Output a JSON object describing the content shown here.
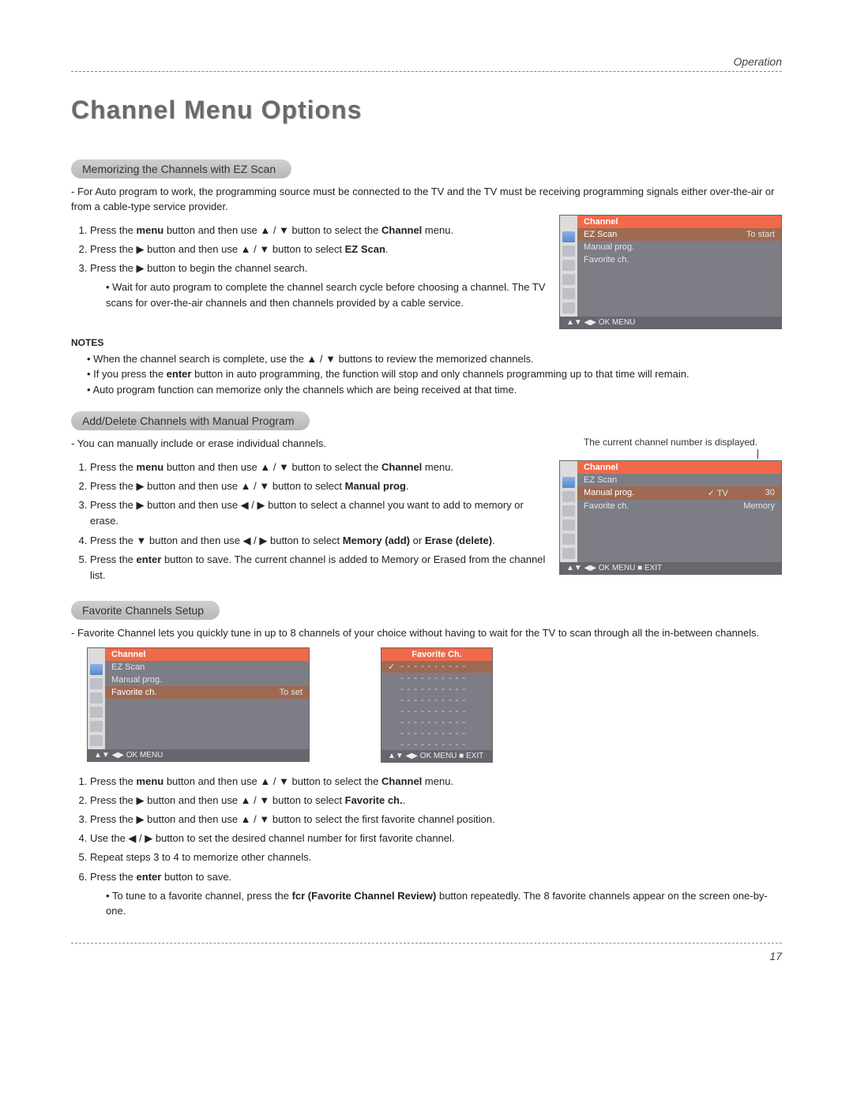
{
  "header": {
    "section": "Operation"
  },
  "title": "Channel Menu Options",
  "page_number": "17",
  "sec1": {
    "pill": "Memorizing the Channels with EZ Scan",
    "intro": "- For Auto program to work, the programming source must be connected to the TV and the TV must be receiving programming signals either over-the-air or from a cable-type service provider.",
    "step1_a": "Press the ",
    "step1_menu": "menu",
    "step1_b": " button and then use ▲ / ▼ button to select the ",
    "step1_channel": "Channel",
    "step1_c": " menu.",
    "step2_a": "Press the ▶ button and then use ▲ / ▼ button to select ",
    "step2_bold": "EZ Scan",
    "step2_b": ".",
    "step3": "Press the ▶ button to begin the channel search.",
    "step3_sub": "Wait for auto program to complete the channel search cycle before choosing a channel. The TV scans for over-the-air channels and then channels provided by a cable service.",
    "notes_label": "NOTES",
    "note1": "When the channel search is complete, use the ▲ / ▼ buttons to review the memorized channels.",
    "note2_a": "If you press the ",
    "note2_bold": "enter",
    "note2_b": " button in auto programming, the function will stop and only channels programming up to that time will remain.",
    "note3": "Auto program function can memorize only the channels which are being received at that time."
  },
  "sec2": {
    "pill": "Add/Delete Channels with Manual Program",
    "intro": "-  You can manually include or erase individual channels.",
    "caption": "The current channel number is displayed.",
    "step1_a": "Press the ",
    "step1_menu": "menu",
    "step1_b": " button and then use ▲ / ▼ button to select the ",
    "step1_channel": "Channel",
    "step1_c": " menu.",
    "step2_a": "Press the ▶ button and then use ▲ / ▼ button to select ",
    "step2_bold": "Manual prog",
    "step2_b": ".",
    "step3": "Press the ▶ button and then use ◀ / ▶ button to select a channel you want to add to memory or erase.",
    "step4_a": "Press the ▼ button and then use ◀ / ▶ button to select ",
    "step4_bold1": "Memory (add)",
    "step4_mid": " or ",
    "step4_bold2": "Erase (delete)",
    "step4_b": ".",
    "step5_a": "Press the ",
    "step5_bold": "enter",
    "step5_b": " button to save. The current channel is added to Memory or Erased from the channel list."
  },
  "sec3": {
    "pill": "Favorite Channels Setup",
    "intro": "-  Favorite Channel lets you quickly tune in up to 8 channels of your choice without having to wait for the TV to scan through all the in-between channels.",
    "step1_a": "Press the ",
    "step1_menu": "menu",
    "step1_b": " button and then use ▲ / ▼ button to select the ",
    "step1_channel": "Channel",
    "step1_c": " menu.",
    "step2_a": "Press the ▶ button and then use ▲ / ▼ button to select ",
    "step2_bold": "Favorite ch.",
    "step2_b": ".",
    "step3": "Press the ▶ button and then use ▲ / ▼ button to select the first favorite channel position.",
    "step4": "Use the ◀ / ▶ button to set the desired channel number for first favorite channel.",
    "step5": "Repeat steps 3 to 4 to memorize other channels.",
    "step6_a": "Press the ",
    "step6_bold": "enter",
    "step6_b": " button to save.",
    "step6_sub_a": "To tune to a favorite channel, press the ",
    "step6_sub_bold": "fcr (Favorite Channel Review)",
    "step6_sub_b": " button repeatedly. The 8 favorite channels appear on the screen one-by-one."
  },
  "osd1": {
    "title": "Channel",
    "items": [
      {
        "label": "EZ Scan",
        "value": "To start",
        "selected": true
      },
      {
        "label": "Manual prog.",
        "value": ""
      },
      {
        "label": "Favorite ch.",
        "value": ""
      }
    ],
    "foot": "▲▼  ◀▶  OK  MENU"
  },
  "osd2": {
    "title": "Channel",
    "items": [
      {
        "label": "EZ Scan",
        "value": ""
      },
      {
        "label": "Manual prog.",
        "value": "✓ TV",
        "value2": "30",
        "selected": true
      },
      {
        "label": "Favorite ch.",
        "value": "Memory"
      }
    ],
    "foot": "▲▼  ◀▶  OK  MENU  ■ EXIT"
  },
  "osd3": {
    "title": "Channel",
    "items": [
      {
        "label": "EZ Scan",
        "value": ""
      },
      {
        "label": "Manual prog.",
        "value": ""
      },
      {
        "label": "Favorite ch.",
        "value": "To set",
        "selected": true
      }
    ],
    "foot": "▲▼  ◀▶  OK  MENU"
  },
  "osd4": {
    "title": "Favorite Ch.",
    "rows": [
      {
        "check": "✓",
        "value": "- - - - - - - - - -",
        "selected": true
      },
      {
        "check": "",
        "value": "- - - - - - - - - -"
      },
      {
        "check": "",
        "value": "- - - - - - - - - -"
      },
      {
        "check": "",
        "value": "- - - - - - - - - -"
      },
      {
        "check": "",
        "value": "- - - - - - - - - -"
      },
      {
        "check": "",
        "value": "- - - - - - - - - -"
      },
      {
        "check": "",
        "value": "- - - - - - - - - -"
      },
      {
        "check": "",
        "value": "- - - - - - - - - -"
      }
    ],
    "foot": "▲▼  ◀▶  OK  MENU  ■ EXIT"
  }
}
